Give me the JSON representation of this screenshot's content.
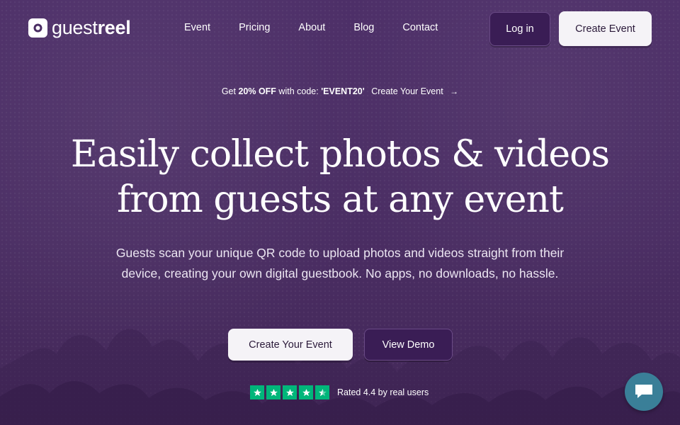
{
  "brand": {
    "name_light": "guest",
    "name_bold": "reel"
  },
  "nav": {
    "items": [
      "Event",
      "Pricing",
      "About",
      "Blog",
      "Contact"
    ]
  },
  "header": {
    "login_label": "Log in",
    "create_label": "Create Event"
  },
  "promo": {
    "prefix": "Get ",
    "discount": "20% OFF",
    "middle": " with code: ",
    "code": "'EVENT20'",
    "cta": "Create Your Event"
  },
  "hero": {
    "title_line1": "Easily collect photos & videos",
    "title_line2": "from guests at any event",
    "subtitle": "Guests scan your unique QR code to upload photos and videos straight from their device, creating your own digital guestbook. No apps, no downloads, no hassle.",
    "primary_cta": "Create Your Event",
    "secondary_cta": "View Demo"
  },
  "rating": {
    "text": "Rated 4.4 by real users",
    "stars_full": 4,
    "stars_half": 1
  },
  "colors": {
    "background": "#4a2d63",
    "accent_dark": "#3a1d55",
    "button_light": "#f5f3f7",
    "star_green": "#00b67a",
    "chat": "#3a7f98"
  },
  "icons": {
    "chat": "chat-bubble-icon",
    "arrow": "arrow-right-icon",
    "star": "star-icon"
  }
}
